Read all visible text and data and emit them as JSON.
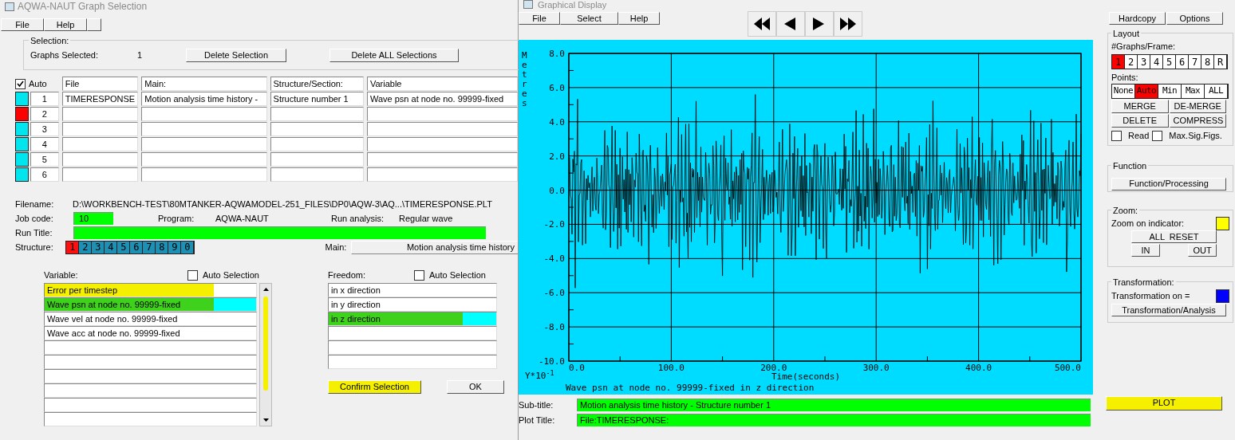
{
  "selection_window": {
    "title": "AQWA-NAUT Graph Selection",
    "menu": [
      "File",
      "Help"
    ],
    "selection": {
      "legend": "Selection:",
      "graphs_selected_label": "Graphs Selected:",
      "graphs_selected": "1",
      "buttons": [
        "Delete Selection",
        "Delete ALL Selections"
      ]
    },
    "table": {
      "auto": {
        "label": "Auto",
        "checked": true
      },
      "columns": [
        "File",
        "Main:",
        "Structure/Section:",
        "Variable"
      ],
      "rows": [
        {
          "number": "1",
          "color": "#00e5ee",
          "cells": [
            "TIMERESPONSE",
            "Motion analysis time history -",
            "Structure number 1",
            "Wave psn at node no. 99999-fixed"
          ]
        },
        {
          "number": "2",
          "color": "#ff0000"
        },
        {
          "number": "3",
          "color": "#00e5ee"
        },
        {
          "number": "4",
          "color": "#00e5ee"
        },
        {
          "number": "5",
          "color": "#00e5ee"
        },
        {
          "number": "6",
          "color": "#00e5ee"
        }
      ]
    },
    "info": {
      "filename_label": "Filename:",
      "filename": "D:\\WORKBENCH-TEST\\80MTANKER-AQWAMODEL-251_FILES\\DP0\\AQW-3\\AQ...\\TIMERESPONSE.PLT",
      "job_code_label": "Job code:",
      "job_code": "10",
      "program_label": "Program:",
      "program": "AQWA-NAUT",
      "run_analysis_label": "Run analysis:",
      "run_analysis": "Regular wave",
      "run_title_label": "Run Title:",
      "structure_label": "Structure:",
      "structures": [
        {
          "label": "1",
          "selected": true
        },
        {
          "label": "2",
          "selected": false
        },
        {
          "label": "3",
          "selected": false
        },
        {
          "label": "4",
          "selected": false
        },
        {
          "label": "5",
          "selected": false
        },
        {
          "label": "6",
          "selected": false
        },
        {
          "label": "7",
          "selected": false
        },
        {
          "label": "8",
          "selected": false
        },
        {
          "label": "9",
          "selected": false
        },
        {
          "label": "0",
          "selected": false
        }
      ],
      "main_label": "Main:",
      "main": "Motion analysis time history"
    },
    "variable": {
      "label": "Variable:",
      "auto_selection": {
        "label": "Auto Selection",
        "checked": false
      },
      "items": [
        {
          "text": "Error per timestep",
          "selected": false,
          "highlighted": true
        },
        {
          "text": "Wave psn at node no. 99999-fixed",
          "selected": true,
          "highlighted": true
        },
        {
          "text": "Wave vel at node no. 99999-fixed",
          "selected": false,
          "highlighted": false
        },
        {
          "text": "Wave acc at node no. 99999-fixed",
          "selected": false,
          "highlighted": false
        }
      ]
    },
    "freedom": {
      "label": "Freedom:",
      "auto_selection": {
        "label": "Auto Selection",
        "checked": false
      },
      "items": [
        {
          "text": "in x direction",
          "selected": false,
          "highlighted": false
        },
        {
          "text": "in y direction",
          "selected": false,
          "highlighted": false
        },
        {
          "text": "in z direction",
          "selected": true,
          "highlighted": true
        }
      ]
    },
    "buttons": [
      {
        "label": "Confirm Selection",
        "highlighted": true
      },
      {
        "label": "OK",
        "highlighted": false
      }
    ]
  },
  "graph_window": {
    "title": "Graphical Display",
    "menu": [
      "File",
      "Select",
      "Help"
    ],
    "plot": {
      "ylabel": "Metres",
      "yticks": [
        "8.0",
        "6.0",
        "4.0",
        "2.0",
        "0.0",
        "-2.0",
        "-4.0",
        "-6.0",
        "-8.0",
        "-10.0"
      ],
      "xticks": [
        "0.0",
        "100.0",
        "200.0",
        "300.0",
        "400.0",
        "500.0"
      ],
      "xlabel": "Time(seconds)",
      "scale": "Y*10$^{-1}$",
      "caption": "Wave psn at node no. 99999-fixed  in z direction"
    },
    "subtitle_label": "Sub-title:",
    "subtitle": "Motion analysis time history - Structure number 1",
    "plot_title_label": "Plot Title:",
    "plot_title": "File:TIMERESPONSE:",
    "plot_button": {
      "label": "PLOT",
      "highlighted": true
    },
    "panel": {
      "top_buttons": [
        "Hardcopy",
        "Options"
      ],
      "layout_legend": "Layout",
      "graphs_frame_label": "#Graphs/Frame:",
      "graphs_frame": [
        {
          "label": "1",
          "selected": true
        },
        {
          "label": "2",
          "selected": false
        },
        {
          "label": "3",
          "selected": false
        },
        {
          "label": "4",
          "selected": false
        },
        {
          "label": "5",
          "selected": false
        },
        {
          "label": "6",
          "selected": false
        },
        {
          "label": "7",
          "selected": false
        },
        {
          "label": "8",
          "selected": false
        },
        {
          "label": "R",
          "selected": false
        }
      ],
      "points_label": "Points:",
      "points": [
        {
          "label": "None",
          "selected": false
        },
        {
          "label": "Auto",
          "selected": true
        },
        {
          "label": "Min",
          "selected": false
        },
        {
          "label": "Max",
          "selected": false
        },
        {
          "label": "ALL",
          "selected": false
        }
      ],
      "actions": [
        "MERGE",
        "DE-MERGE",
        "DELETE",
        "COMPRESS"
      ],
      "checks": [
        {
          "label": "Read",
          "checked": false
        },
        {
          "label": "Max.Sig.Figs.",
          "checked": false
        }
      ],
      "function_legend": "Function",
      "function_button": "Function/Processing",
      "zoom_legend": "Zoom:",
      "zoom_indicator_label": "Zoom on indicator:",
      "zoom_indicator": {
        "color": "#ffff00"
      },
      "zoom_buttons": [
        "ALL  RESET",
        "IN",
        "OUT"
      ],
      "transformation_legend": "Transformation:",
      "transformation_label": "Transformation on =",
      "transformation_indicator": {
        "color": "#0000ff"
      },
      "transformation_button": "Transformation/Analysis"
    }
  }
}
